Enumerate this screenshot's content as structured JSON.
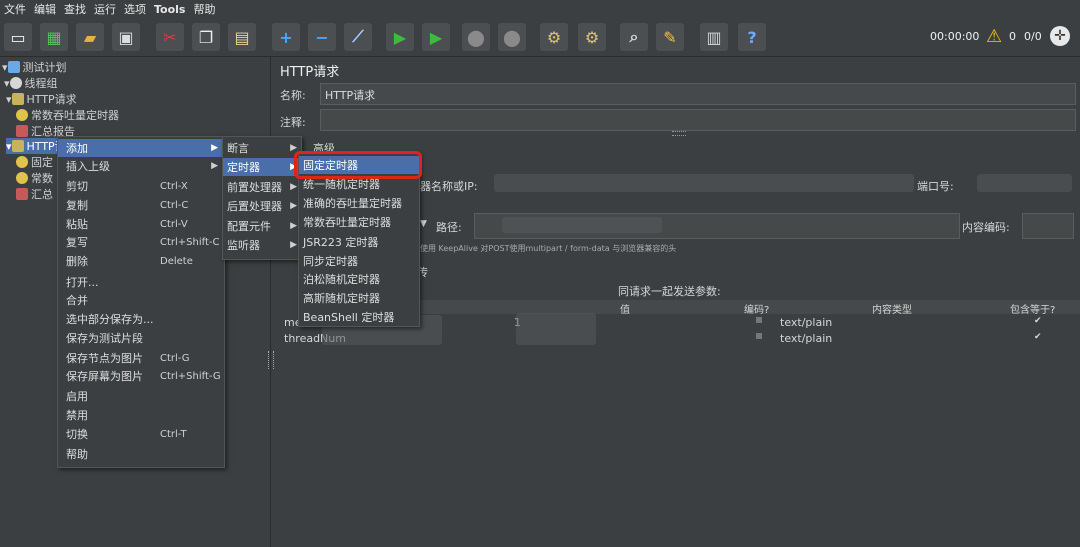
{
  "menubar": {
    "items": [
      "文件",
      "编辑",
      "查找",
      "运行",
      "选项",
      "Tools",
      "帮助"
    ]
  },
  "toolbar": {
    "timer": "00:00:00",
    "warn_count": "0",
    "thread_ratio": "0/0"
  },
  "tree": {
    "items": [
      {
        "label": "测试计划"
      },
      {
        "label": "线程组"
      },
      {
        "label": "HTTP请求"
      },
      {
        "label": "常数吞吐量定时器"
      },
      {
        "label": "汇总报告"
      },
      {
        "label": "HTTP请"
      },
      {
        "label": "固定"
      },
      {
        "label": "常数"
      },
      {
        "label": "汇总"
      }
    ]
  },
  "panel": {
    "title": "HTTP请求",
    "name_label": "名称:",
    "name_value": "HTTP请求",
    "comment_label": "注释:",
    "basic_tab": "高级",
    "server_label": "服务器名称或IP:",
    "port_label": "端口号:",
    "path_label": "路径:",
    "encoding_label": "内容编码:",
    "options_text": "使用 KeepAlive  对POST使用multipart / form-data  与浏览器兼容的头",
    "send_params": "同请求一起发送参数:",
    "col_value": "值",
    "col_encode": "编码?",
    "col_content_type": "内容类型",
    "col_include_eq": "包含等于?",
    "rows": [
      {
        "name": "me",
        "value": "1",
        "content_type": "text/plain"
      },
      {
        "name": "threadNum",
        "value": "",
        "content_type": "text/plain"
      }
    ],
    "upload_label": "传"
  },
  "context_menu": {
    "items": [
      {
        "label": "添加",
        "shortcut": ""
      },
      {
        "label": "插入上级",
        "shortcut": ""
      },
      {
        "label": "剪切",
        "shortcut": "Ctrl-X"
      },
      {
        "label": "复制",
        "shortcut": "Ctrl-C"
      },
      {
        "label": "粘贴",
        "shortcut": "Ctrl-V"
      },
      {
        "label": "复写",
        "shortcut": "Ctrl+Shift-C"
      },
      {
        "label": "删除",
        "shortcut": "Delete"
      },
      {
        "label": "打开...",
        "shortcut": ""
      },
      {
        "label": "合并",
        "shortcut": ""
      },
      {
        "label": "选中部分保存为...",
        "shortcut": ""
      },
      {
        "label": "保存为测试片段",
        "shortcut": ""
      },
      {
        "label": "保存节点为图片",
        "shortcut": "Ctrl-G"
      },
      {
        "label": "保存屏幕为图片",
        "shortcut": "Ctrl+Shift-G"
      },
      {
        "label": "启用",
        "shortcut": ""
      },
      {
        "label": "禁用",
        "shortcut": ""
      },
      {
        "label": "切换",
        "shortcut": "Ctrl-T"
      },
      {
        "label": "帮助",
        "shortcut": ""
      }
    ]
  },
  "submenu1": {
    "items": [
      "断言",
      "定时器",
      "前置处理器",
      "后置处理器",
      "配置元件",
      "监听器"
    ]
  },
  "submenu2": {
    "items": [
      "固定定时器",
      "统一随机定时器",
      "准确的吞吐量定时器",
      "常数吞吐量定时器",
      "JSR223 定时器",
      "同步定时器",
      "泊松随机定时器",
      "高斯随机定时器",
      "BeanShell 定时器"
    ]
  },
  "colors": {
    "highlight": "#4a6ea9",
    "red_box": "#e0231b",
    "bg": "#3c3f41"
  }
}
